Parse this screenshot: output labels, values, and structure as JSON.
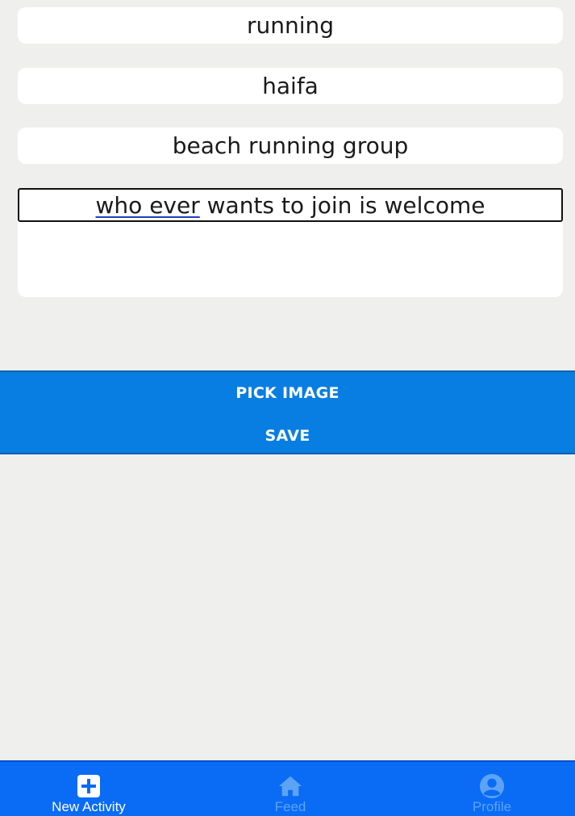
{
  "form": {
    "activity_type": "running",
    "location": "haifa",
    "title": "beach running group",
    "description_underlined": "who ever",
    "description_rest": " wants to join is welcome"
  },
  "actions": {
    "pick_image_label": "PICK IMAGE",
    "save_label": "SAVE"
  },
  "tabs": [
    {
      "label": "New Activity",
      "icon": "plus-square-icon",
      "active": true
    },
    {
      "label": "Feed",
      "icon": "home-icon",
      "active": false
    },
    {
      "label": "Profile",
      "icon": "user-circle-icon",
      "active": false
    }
  ],
  "colors": {
    "background": "#efefed",
    "action_panel": "#087ee3",
    "tabbar": "#0a6bf5",
    "tab_inactive": "#5ca3f5"
  }
}
